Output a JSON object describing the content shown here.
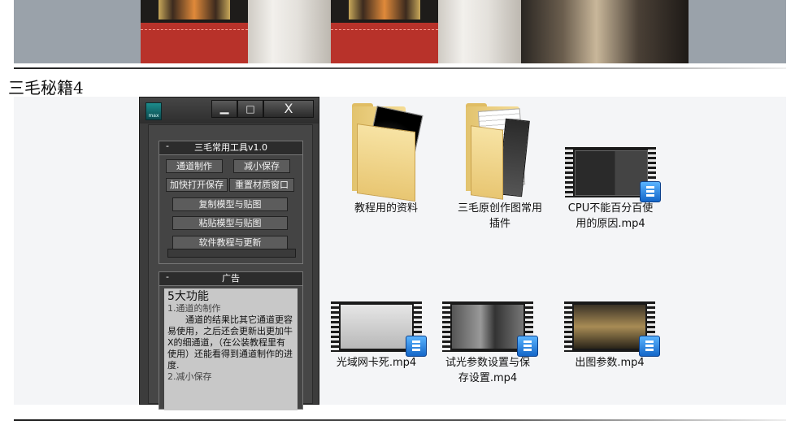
{
  "section_title": "三毛秘籍4",
  "panel": {
    "window_buttons": {
      "minimize": "▁",
      "maximize": "□",
      "close": "X"
    },
    "app_icon_text": "max",
    "tools_rollout": {
      "toggle": "-",
      "title": "三毛常用工具v1.0",
      "buttons": {
        "channel": "通道制作",
        "reduce_save": "减小保存",
        "fast_open_save": "加快打开保存",
        "reset_material": "重置材质窗口",
        "copy_model": "复制模型与贴图",
        "paste_model": "粘贴模型与贴图",
        "tutorial_update": "软件教程与更新"
      }
    },
    "ad_rollout": {
      "toggle": "-",
      "title": "广告",
      "headline": "5大功能",
      "item1": "1.通道的制作",
      "para1": "通道的结果比其它通道更容易使用，之后还会更新出更加牛X的细通道，（在公装教程里有使用）还能看得到通道制作的进度.",
      "item2": "2.减小保存"
    }
  },
  "files": [
    {
      "name": "教程用的资料",
      "type": "folder-icon"
    },
    {
      "name": "三毛原创作图常用插件",
      "type": "folder-icon"
    },
    {
      "name": "CPU不能百分百使用的原因.mp4",
      "type": "video-icon"
    },
    {
      "name": "光域网卡死.mp4",
      "type": "video-icon"
    },
    {
      "name": "试光参数设置与保存设置.mp4",
      "type": "video-icon"
    },
    {
      "name": "出图参数.mp4",
      "type": "video-icon"
    }
  ]
}
